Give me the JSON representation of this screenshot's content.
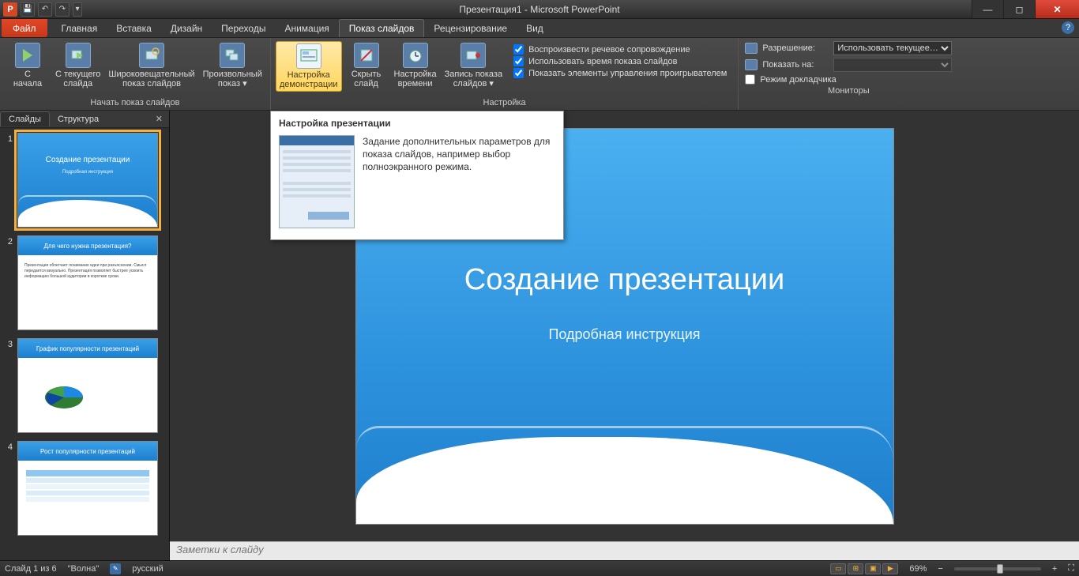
{
  "window": {
    "title": "Презентация1 - Microsoft PowerPoint",
    "app_initial": "P"
  },
  "qat": {
    "save": "💾",
    "undo": "↶",
    "redo": "↷",
    "dropdown": "▾"
  },
  "tabs": {
    "file": "Файл",
    "items": [
      {
        "label": "Главная"
      },
      {
        "label": "Вставка"
      },
      {
        "label": "Дизайн"
      },
      {
        "label": "Переходы"
      },
      {
        "label": "Анимация"
      },
      {
        "label": "Показ слайдов",
        "active": true
      },
      {
        "label": "Рецензирование"
      },
      {
        "label": "Вид"
      }
    ]
  },
  "ribbon": {
    "group_start": {
      "label": "Начать показ слайдов",
      "btn_from_start": "С\nначала",
      "btn_from_current": "С текущего\nслайда",
      "btn_broadcast": "Широковещательный\nпоказ слайдов",
      "btn_custom": "Произвольный\nпоказ ▾"
    },
    "group_setup": {
      "label": "Настройка",
      "btn_setup": "Настройка\nдемонстрации",
      "btn_hide": "Скрыть\nслайд",
      "btn_rehearse": "Настройка\nвремени",
      "btn_record": "Запись показа\nслайдов ▾",
      "chk_narration": "Воспроизвести речевое сопровождение",
      "chk_timings": "Использовать время показа слайдов",
      "chk_media": "Показать элементы управления проигрывателем"
    },
    "group_monitors": {
      "label": "Мониторы",
      "lbl_resolution": "Разрешение:",
      "val_resolution": "Использовать текущее…",
      "lbl_show_on": "Показать на:",
      "val_show_on": "",
      "chk_presenter": "Режим докладчика"
    }
  },
  "tooltip": {
    "title": "Настройка презентации",
    "body": "Задание дополнительных параметров для показа слайдов, например выбор полноэкранного режима."
  },
  "thumb_panel": {
    "tab_slides": "Слайды",
    "tab_outline": "Структура",
    "slides": [
      {
        "n": "1",
        "title": "Создание презентации",
        "sub": "Подробная инструкция",
        "kind": "title"
      },
      {
        "n": "2",
        "title": "Для чего нужна презентация?",
        "kind": "content"
      },
      {
        "n": "3",
        "title": "График популярности презентаций",
        "kind": "chart"
      },
      {
        "n": "4",
        "title": "Рост популярности презентаций",
        "kind": "table"
      }
    ]
  },
  "slide": {
    "title": "Создание презентации",
    "subtitle": "Подробная инструкция"
  },
  "notes": {
    "placeholder": "Заметки к слайду"
  },
  "status": {
    "slide_pos": "Слайд 1 из 6",
    "theme": "\"Волна\"",
    "language": "русский",
    "zoom": "69%"
  }
}
